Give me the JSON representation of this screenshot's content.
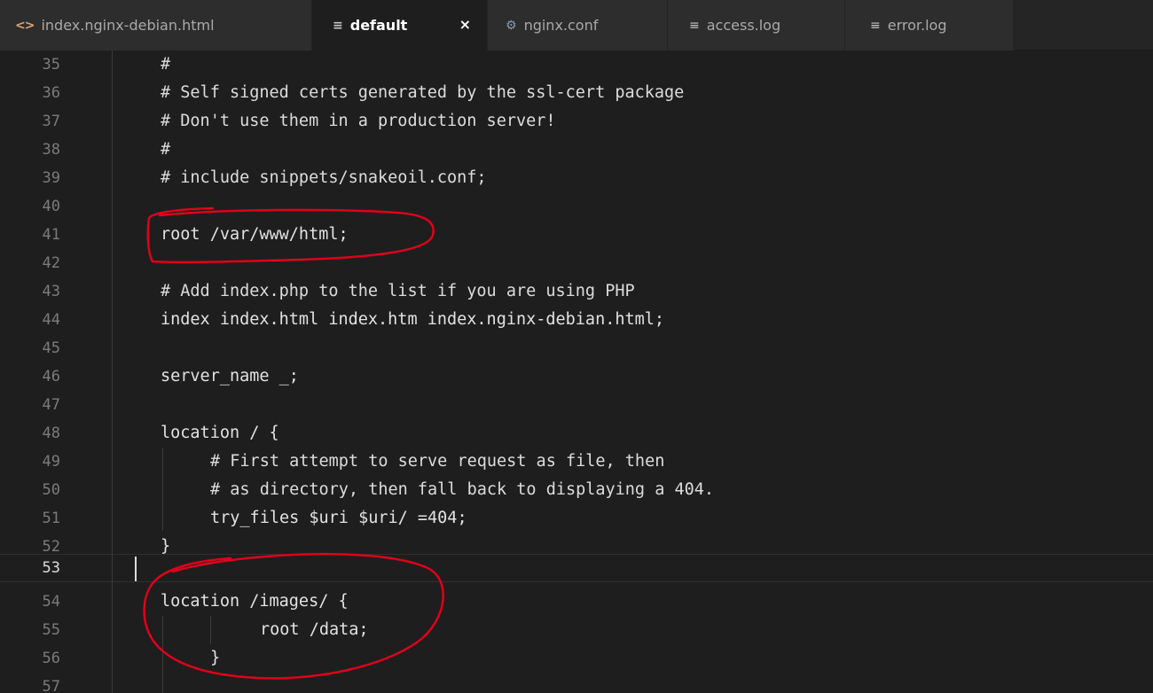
{
  "tabs": [
    {
      "label": "index.nginx-debian.html",
      "icon": "code-file-icon"
    },
    {
      "label": "default",
      "icon": "text-file-icon",
      "active": true,
      "close": "×"
    },
    {
      "label": "nginx.conf",
      "icon": "gear-icon"
    },
    {
      "label": "access.log",
      "icon": "text-file-icon"
    },
    {
      "label": "error.log",
      "icon": "text-file-icon"
    }
  ],
  "icons": {
    "code": "<>",
    "lines": "≡",
    "gear": "⚙"
  },
  "lines": [
    {
      "number": "35",
      "text": "#"
    },
    {
      "number": "36",
      "text": "# Self signed certs generated by the ssl-cert package"
    },
    {
      "number": "37",
      "text": "# Don't use them in a production server!"
    },
    {
      "number": "38",
      "text": "#"
    },
    {
      "number": "39",
      "text": "# include snippets/snakeoil.conf;"
    },
    {
      "number": "40",
      "text": ""
    },
    {
      "number": "41",
      "text": "root /var/www/html;"
    },
    {
      "number": "42",
      "text": ""
    },
    {
      "number": "43",
      "text": "# Add index.php to the list if you are using PHP"
    },
    {
      "number": "44",
      "text": "index index.html index.htm index.nginx-debian.html;"
    },
    {
      "number": "45",
      "text": ""
    },
    {
      "number": "46",
      "text": "server_name _;"
    },
    {
      "number": "47",
      "text": ""
    },
    {
      "number": "48",
      "text": "location / {"
    },
    {
      "number": "49",
      "text": "# First attempt to serve request as file, then"
    },
    {
      "number": "50",
      "text": "# as directory, then fall back to displaying a 404."
    },
    {
      "number": "51",
      "text": "try_files $uri $uri/ =404;"
    },
    {
      "number": "52",
      "text": "}"
    },
    {
      "number": "53",
      "text": "",
      "current": true
    },
    {
      "number": "54",
      "text": "location /images/ {"
    },
    {
      "number": "55",
      "text": "root /data;"
    },
    {
      "number": "56",
      "text": "}"
    },
    {
      "number": "57",
      "text": ""
    }
  ],
  "colors": {
    "background": "#1e1e1e",
    "annotation": "#e0001b"
  }
}
